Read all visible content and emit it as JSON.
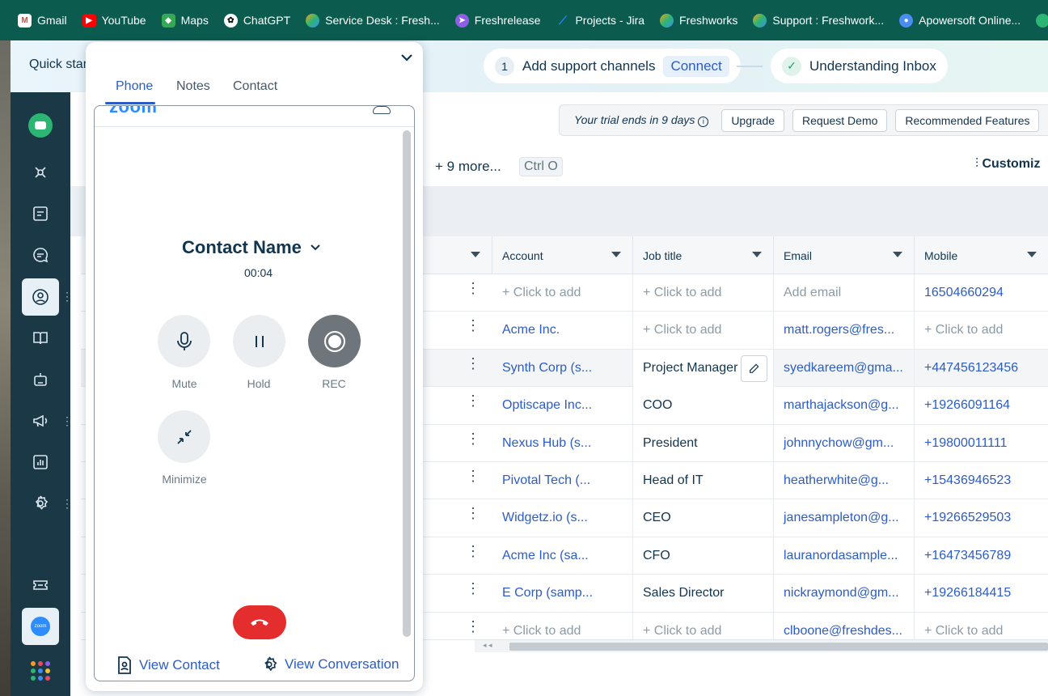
{
  "bookmarks": [
    {
      "label": "Gmail",
      "icon": "gmail-icon",
      "color": "#ea4335"
    },
    {
      "label": "YouTube",
      "icon": "youtube-icon",
      "color": "#ff0000"
    },
    {
      "label": "Maps",
      "icon": "maps-icon",
      "color": "#34a853"
    },
    {
      "label": "ChatGPT",
      "icon": "chatgpt-icon",
      "color": "#ffffff"
    },
    {
      "label": "Service Desk : Fresh...",
      "icon": "freshworks-icon",
      "color": "#f59d1e"
    },
    {
      "label": "Freshrelease",
      "icon": "freshrelease-icon",
      "color": "#8f5ee8"
    },
    {
      "label": "Projects - Jira",
      "icon": "jira-icon",
      "color": "#2684ff"
    },
    {
      "label": "Freshworks",
      "icon": "freshworks-icon",
      "color": "#f59d1e"
    },
    {
      "label": "Support : Freshwork...",
      "icon": "freshworks-icon",
      "color": "#f59d1e"
    },
    {
      "label": "Apowersoft Online...",
      "icon": "apowersoft-icon",
      "color": "#4a8df0"
    }
  ],
  "onboarding": {
    "quick_start": "Quick star",
    "step1_num": "1",
    "step1_label": "Add support channels",
    "step1_action": "Connect",
    "step2_label": "Understanding Inbox"
  },
  "trial": {
    "text": "Your trial ends in 9 days",
    "upgrade": "Upgrade",
    "request_demo": "Request Demo",
    "recommended": "Recommended Features"
  },
  "views": {
    "more": "+ 9 more...",
    "shortcut": "Ctrl O",
    "customize": "Customiz"
  },
  "table": {
    "columns": [
      "Account",
      "Job title",
      "Email",
      "Mobile"
    ],
    "rows": [
      {
        "account": "+ Click to add",
        "job": "+ Click to add",
        "email": "Add email",
        "mobile": "16504660294"
      },
      {
        "account": "Acme Inc.",
        "job": "+ Click to add",
        "email": "matt.rogers@fres...",
        "mobile": "+ Click to add"
      },
      {
        "account": "Synth Corp (s...",
        "job": "Project Manager",
        "email": "syedkareem@gma...",
        "mobile": "+447456123456"
      },
      {
        "account": "Optiscape Inc...",
        "job": "COO",
        "email": "marthajackson@g...",
        "mobile": "+19266091164"
      },
      {
        "account": "Nexus Hub (s...",
        "job": "President",
        "email": "johnnychow@gm...",
        "mobile": "+19800011111"
      },
      {
        "account": "Pivotal Tech (...",
        "job": "Head of IT",
        "email": "heatherwhite@g...",
        "mobile": "+15436946523"
      },
      {
        "account": "Widgetz.io (s...",
        "job": "CEO",
        "email": "janesampleton@g...",
        "mobile": "+19266529503"
      },
      {
        "account": "Acme Inc (sa...",
        "job": "CFO",
        "email": "lauranordasample...",
        "mobile": "+16473456789"
      },
      {
        "account": "E Corp (samp...",
        "job": "Sales Director",
        "email": "nickraymond@gm...",
        "mobile": "+19266184415"
      },
      {
        "account": "+ Click to add",
        "job": "+ Click to add",
        "email": "clboone@freshdes...",
        "mobile": "+ Click to add"
      }
    ]
  },
  "phone": {
    "tabs": [
      "Phone",
      "Notes",
      "Contact"
    ],
    "active_tab": "Phone",
    "logo": "zoom",
    "contact_name": "Contact Name",
    "timer": "00:04",
    "mute": "Mute",
    "hold": "Hold",
    "rec": "REC",
    "minimize": "Minimize",
    "view_contact": "View Contact",
    "view_conversation": "View Conversation",
    "end_call_color": "#e42e2e"
  },
  "colors": {
    "accent": "#2c5cc5",
    "sidebar": "#1b3847",
    "bookmark_bar": "#0b5b4e"
  }
}
